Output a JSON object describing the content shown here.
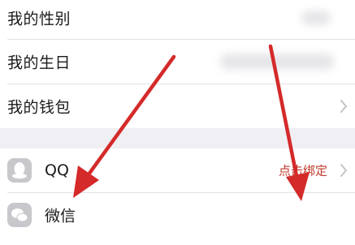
{
  "profile": {
    "gender_label": "我的性别",
    "birthday_label": "我的生日",
    "wallet_label": "我的钱包"
  },
  "accounts": {
    "qq_label": "QQ",
    "qq_status": "点击绑定",
    "wechat_label": "微信"
  },
  "colors": {
    "annotation_arrow": "#d42a2a",
    "bind_text": "#c0392b"
  },
  "icons": {
    "chevron": "chevron-right-icon",
    "qq": "qq-icon",
    "wechat": "wechat-icon"
  }
}
